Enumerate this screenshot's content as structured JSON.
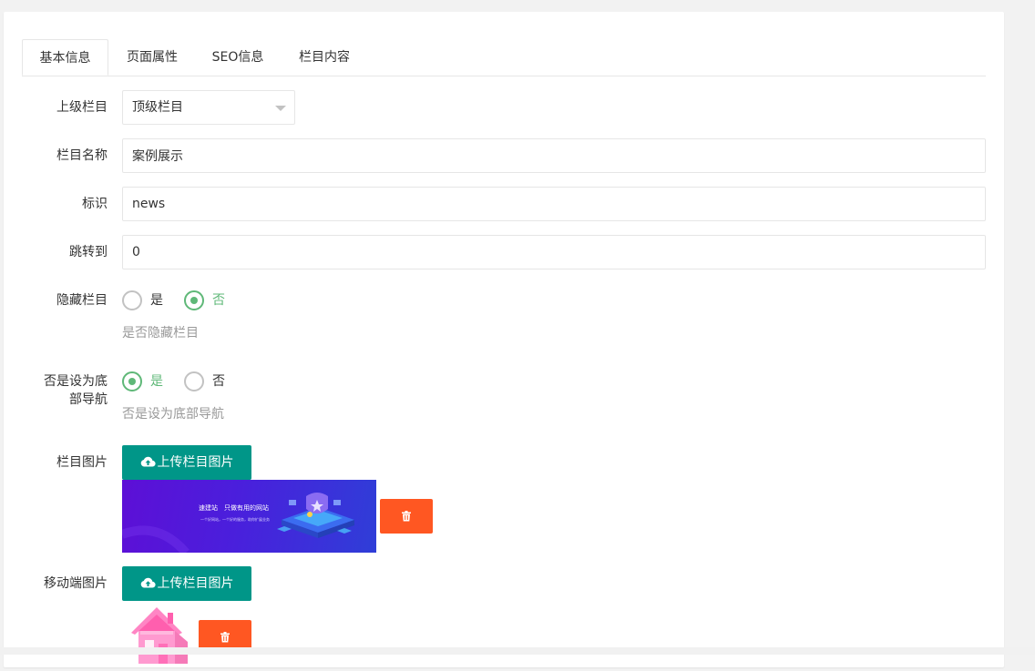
{
  "tabs": [
    {
      "label": "基本信息",
      "active": true
    },
    {
      "label": "页面属性",
      "active": false
    },
    {
      "label": "SEO信息",
      "active": false
    },
    {
      "label": "栏目内容",
      "active": false
    }
  ],
  "form": {
    "parent": {
      "label": "上级栏目",
      "value": "顶级栏目"
    },
    "name": {
      "label": "栏目名称",
      "value": "案例展示"
    },
    "identifier": {
      "label": "标识",
      "value": "news"
    },
    "redirect": {
      "label": "跳转到",
      "value": "0"
    },
    "hidden": {
      "label": "隐藏栏目",
      "options": [
        "是",
        "否"
      ],
      "selected": "否",
      "hint": "是否隐藏栏目"
    },
    "footer_nav": {
      "label_line1": "否是设为底",
      "label_line2": "部导航",
      "options": [
        "是",
        "否"
      ],
      "selected": "是",
      "hint": "否是设为底部导航"
    },
    "image": {
      "label": "栏目图片",
      "upload_label": "上传栏目图片",
      "banner_title": "速建站　只做有用的网站",
      "banner_subtitle": "一个好网站，一个好的服务，助你扩展业务"
    },
    "mobile_image": {
      "label": "移动端图片",
      "upload_label": "上传栏目图片"
    }
  },
  "colors": {
    "primary": "#009688",
    "danger": "#ff5722",
    "checked": "#5fb878",
    "border": "#e6e6e6",
    "hint": "#999999"
  },
  "icons": {
    "upload": "cloud-upload-icon",
    "delete": "trash-icon",
    "select": "caret-down-icon"
  }
}
